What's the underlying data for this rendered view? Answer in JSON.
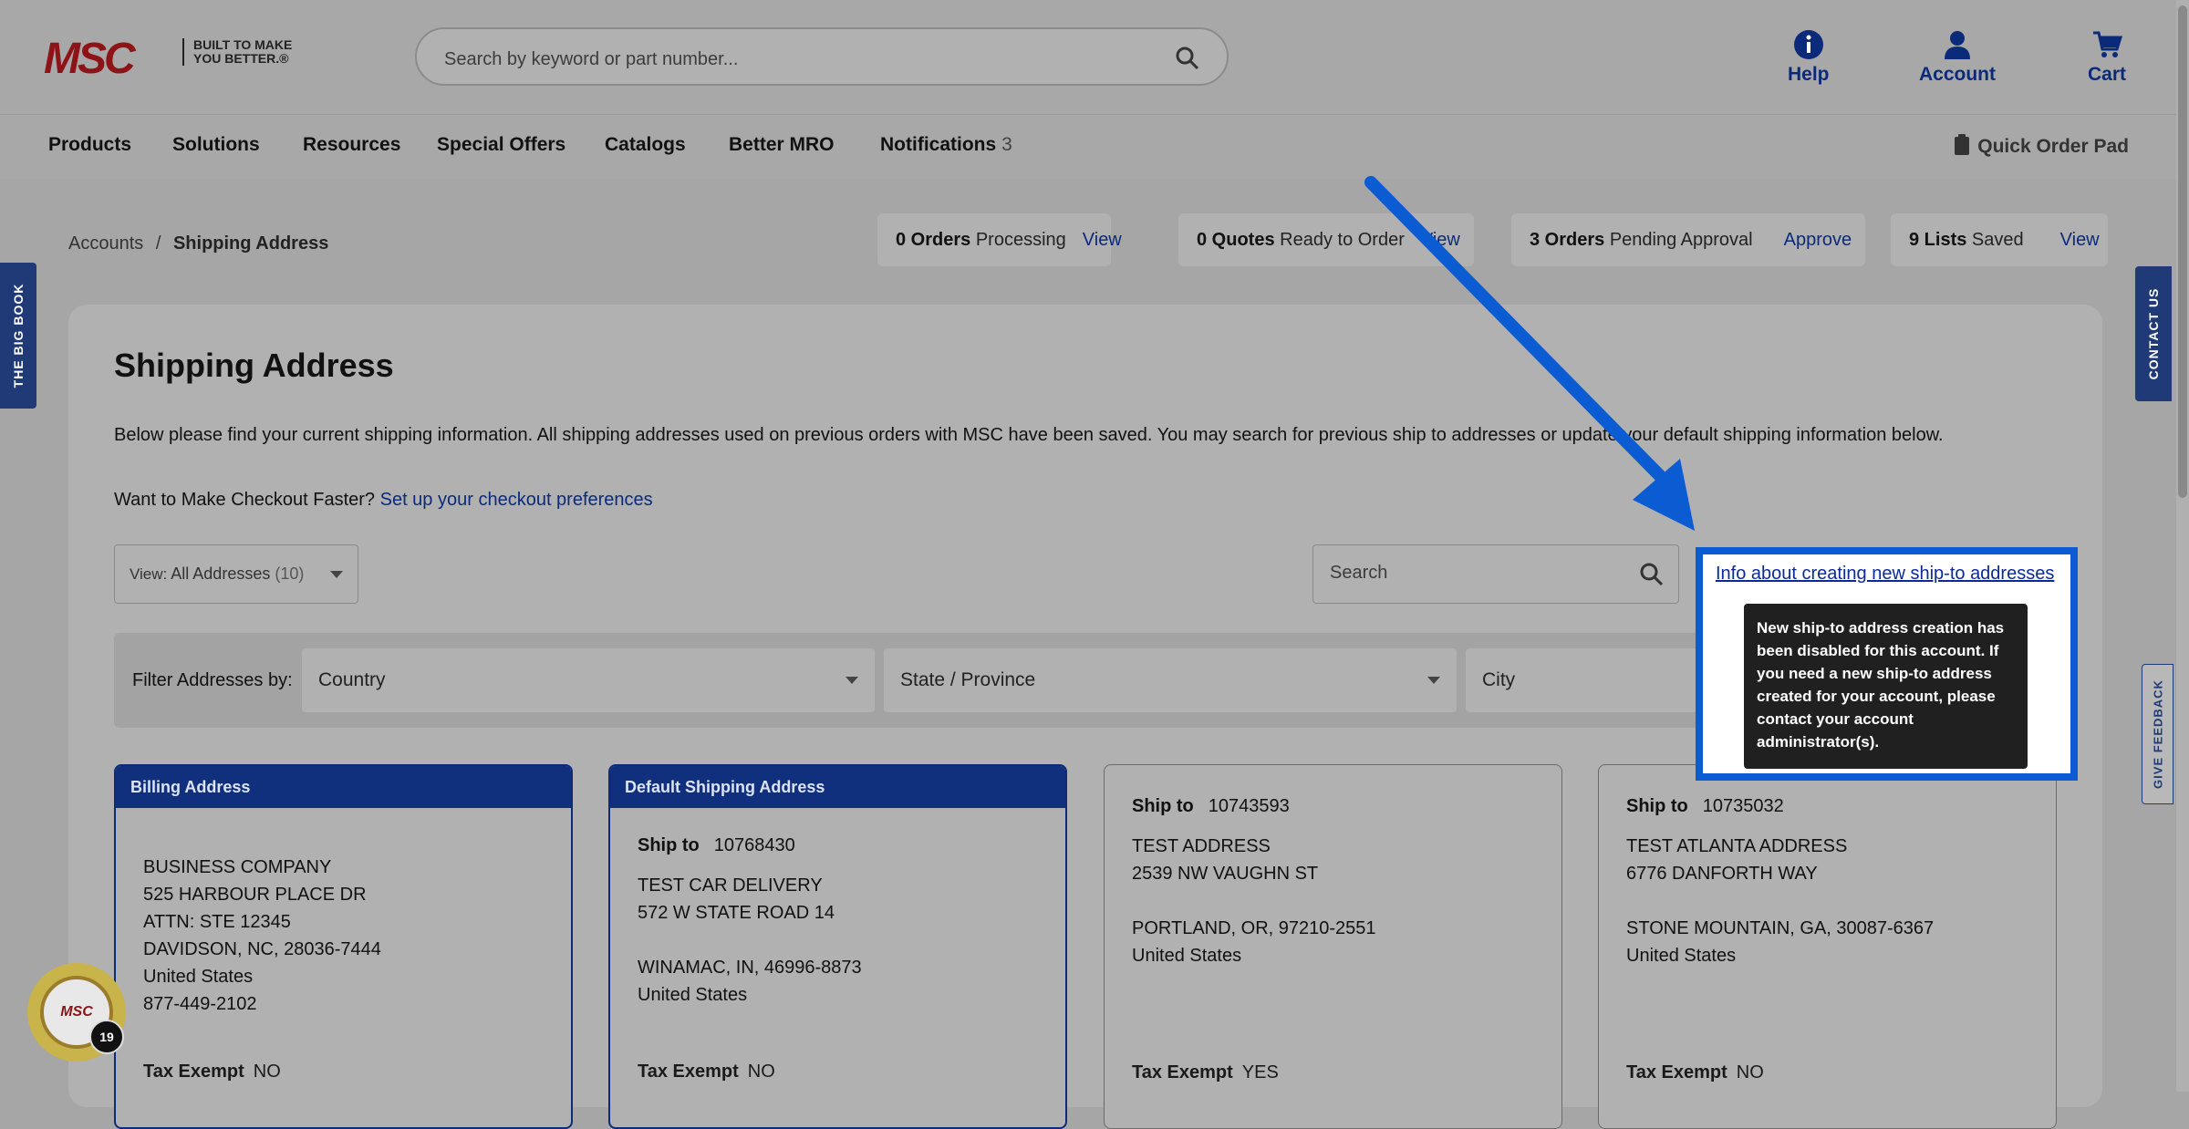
{
  "logo": {
    "brand": "MSC",
    "tagline": "BUILT TO MAKE YOU BETTER.®"
  },
  "search": {
    "placeholder": "Search by keyword or part number..."
  },
  "header_links": {
    "help": "Help",
    "account": "Account",
    "cart": "Cart"
  },
  "nav": {
    "items": [
      "Products",
      "Solutions",
      "Resources",
      "Special Offers",
      "Catalogs",
      "Better MRO",
      "Notifications"
    ],
    "notifications_count": "3",
    "quick_order": "Quick Order Pad"
  },
  "breadcrumb": {
    "parent": "Accounts",
    "sep": "/",
    "current": "Shipping Address"
  },
  "summary": [
    {
      "count": "0 Orders",
      "label": "Processing",
      "action": "View"
    },
    {
      "count": "0 Quotes",
      "label": "Ready to Order",
      "action": "View"
    },
    {
      "count": "3 Orders",
      "label": "Pending Approval",
      "action": "Approve"
    },
    {
      "count": "9 Lists",
      "label": "Saved",
      "action": "View"
    }
  ],
  "side_tabs": {
    "big_book": "THE BIG BOOK",
    "contact": "CONTACT US",
    "feedback": "GIVE FEEDBACK"
  },
  "page": {
    "title": "Shipping Address",
    "intro": "Below please find your current shipping information. All shipping addresses used on previous orders with MSC have been saved. You may search for previous ship to addresses or update your default shipping information below.",
    "checkout_prompt": "Want to Make Checkout Faster?",
    "checkout_link": "Set up your checkout preferences",
    "view_label": "View:",
    "view_value": "All Addresses",
    "view_count": "(10)",
    "search_placeholder": "Search",
    "info_link": "Info about creating new ship-to addresses",
    "tooltip": "New ship-to address creation has been disabled for this account. If you need a new ship-to address created for your account, please contact your account administrator(s)."
  },
  "filters": {
    "label": "Filter Addresses by:",
    "country": "Country",
    "state": "State / Province",
    "city": "City"
  },
  "cards": [
    {
      "header": "Billing Address",
      "ship_to_label": "",
      "ship_to": "",
      "lines": [
        "BUSINESS COMPANY",
        "525 HARBOUR PLACE DR",
        "ATTN: STE 12345",
        "DAVIDSON, NC, 28036-7444",
        "United States",
        "877-449-2102"
      ],
      "tax_label": "Tax Exempt",
      "tax_value": "NO"
    },
    {
      "header": "Default Shipping Address",
      "ship_to_label": "Ship to",
      "ship_to": "10768430",
      "lines": [
        "TEST CAR DELIVERY",
        "572 W STATE ROAD 14",
        "",
        "WINAMAC, IN, 46996-8873",
        "United States"
      ],
      "tax_label": "Tax Exempt",
      "tax_value": "NO"
    },
    {
      "header": "",
      "ship_to_label": "Ship to",
      "ship_to": "10743593",
      "lines": [
        "TEST ADDRESS",
        "2539 NW VAUGHN ST",
        "",
        "PORTLAND, OR, 97210-2551",
        "United States"
      ],
      "tax_label": "Tax Exempt",
      "tax_value": "YES"
    },
    {
      "header": "",
      "ship_to_label": "Ship to",
      "ship_to": "10735032",
      "lines": [
        "TEST ATLANTA ADDRESS",
        "6776 DANFORTH WAY",
        "",
        "STONE MOUNTAIN, GA, 30087-6367",
        "United States"
      ],
      "tax_label": "Tax Exempt",
      "tax_value": "NO"
    }
  ],
  "chat_badge": {
    "brand": "MSC",
    "count": "19"
  },
  "colors": {
    "brand_red": "#8e1317",
    "navy": "#10307d",
    "link": "#0b2a7a",
    "annotation_blue": "#0b5bd3"
  }
}
